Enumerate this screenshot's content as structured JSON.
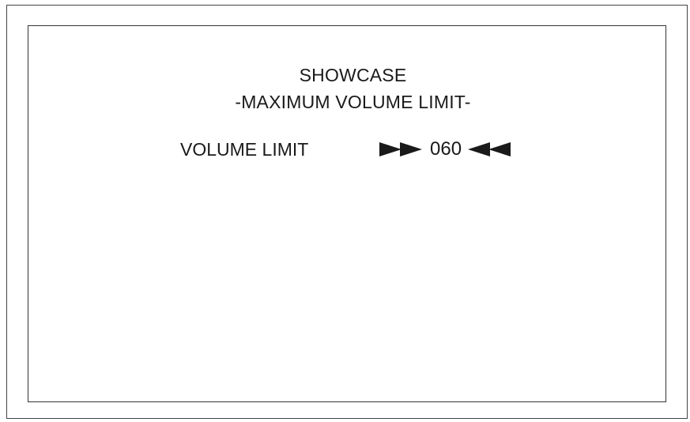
{
  "menu": {
    "title": "SHOWCASE",
    "subtitle": "-MAXIMUM VOLUME LIMIT-"
  },
  "setting": {
    "label": "VOLUME LIMIT",
    "value": "060",
    "increase_icon": "double-right-arrow",
    "decrease_icon": "double-left-arrow"
  },
  "colors": {
    "text": "#1a1a1a",
    "border": "#333333",
    "background": "#ffffff"
  }
}
